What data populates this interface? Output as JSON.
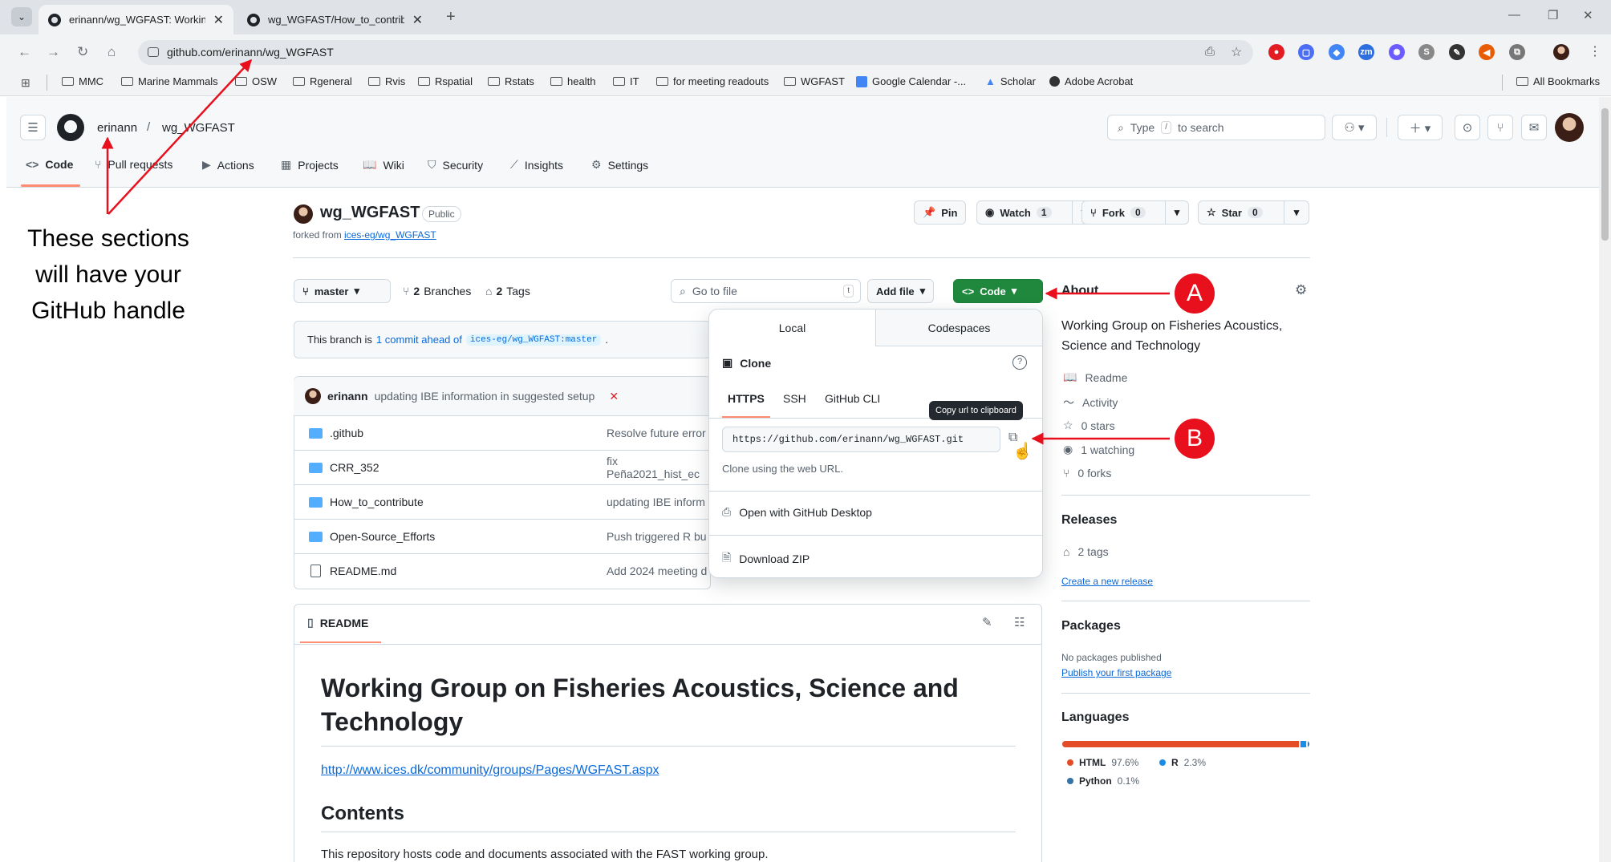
{
  "browser": {
    "tabs": [
      {
        "title": "erinann/wg_WGFAST: Working",
        "active": true
      },
      {
        "title": "wg_WGFAST/How_to_contribut",
        "active": false
      }
    ],
    "new_tab": "+",
    "url": "github.com/erinann/wg_WGFAST",
    "bookmarks": [
      "MMC",
      "Marine Mammals",
      "OSW",
      "Rgeneral",
      "Rvis",
      "Rspatial",
      "Rstats",
      "health",
      "IT",
      "for meeting readouts",
      "WGFAST",
      "Google Calendar -...",
      "Scholar",
      "Adobe Acrobat"
    ],
    "all_bookmarks": "All Bookmarks",
    "ext_zm": "zm",
    "ext_s": "S"
  },
  "header": {
    "owner": "erinann",
    "separator": "/",
    "repo": "wg_WGFAST",
    "search_placeholder_pre": "Type",
    "search_kbd": "/",
    "search_placeholder_post": "to search",
    "nav": [
      "Code",
      "Pull requests",
      "Actions",
      "Projects",
      "Wiki",
      "Security",
      "Insights",
      "Settings"
    ]
  },
  "repo": {
    "name": "wg_WGFAST",
    "visibility": "Public",
    "forked_from_label": "forked from",
    "forked_from": "ices-eg/wg_WGFAST",
    "pin": "Pin",
    "watch": "Watch",
    "watch_count": "1",
    "fork": "Fork",
    "fork_count": "0",
    "star": "Star",
    "star_count": "0",
    "branch": "master",
    "branches_count": "2",
    "branches_label": "Branches",
    "tags_count": "2",
    "tags_label": "Tags",
    "go_to_file": "Go to file",
    "go_to_file_kbd": "t",
    "add_file": "Add file",
    "code_button": "Code",
    "ahead_pre": "This branch is",
    "ahead_link": "1 commit ahead of",
    "ahead_ref": "ices-eg/wg_WGFAST:master",
    "ahead_post": ".",
    "commit_author": "erinann",
    "commit_message": "updating IBE information in suggested setup",
    "commit_status": "✕",
    "files": [
      {
        "name": ".github",
        "type": "dir",
        "message": "Resolve future error"
      },
      {
        "name": "CRR_352",
        "type": "dir",
        "message": "fix Peña2021_hist_ec"
      },
      {
        "name": "How_to_contribute",
        "type": "dir",
        "message": "updating IBE inform"
      },
      {
        "name": "Open-Source_Efforts",
        "type": "dir",
        "message": "Push triggered R bu"
      },
      {
        "name": "README.md",
        "type": "file",
        "message": "Add 2024 meeting d"
      }
    ],
    "readme_tab": "README",
    "readme_title": "Working Group on Fisheries Acoustics, Science and Technology",
    "readme_link": "http://www.ices.dk/community/groups/Pages/WGFAST.aspx",
    "readme_contents": "Contents",
    "readme_para": "This repository hosts code and documents associated with the FAST working group."
  },
  "code_dropdown": {
    "tabs": [
      "Local",
      "Codespaces"
    ],
    "clone_title": "Clone",
    "protocols": [
      "HTTPS",
      "SSH",
      "GitHub CLI"
    ],
    "clone_url": "https://github.com/erinann/wg_WGFAST.git",
    "hint": "Clone using the web URL.",
    "desktop": "Open with GitHub Desktop",
    "zip": "Download ZIP",
    "tooltip": "Copy url to clipboard"
  },
  "sidebar": {
    "about_title": "About",
    "description": "Working Group on Fisheries Acoustics, Science and Technology",
    "readme": "Readme",
    "activity": "Activity",
    "stars": "0 stars",
    "watching": "1 watching",
    "forks": "0 forks",
    "releases_title": "Releases",
    "tags": "2 tags",
    "create_release": "Create a new release",
    "packages_title": "Packages",
    "no_packages": "No packages published",
    "publish_package": "Publish your first package",
    "languages_title": "Languages",
    "languages": [
      {
        "name": "HTML",
        "percent": "97.6%",
        "value": 97.6,
        "color": "#e34c26"
      },
      {
        "name": "R",
        "percent": "2.3%",
        "value": 2.3,
        "color": "#198ce7"
      },
      {
        "name": "Python",
        "percent": "0.1%",
        "value": 0.1,
        "color": "#3572a5"
      }
    ]
  },
  "annotations": {
    "callout": "These sections will have your GitHub handle",
    "marker_a": "A",
    "marker_b": "B",
    "arrow_color": "#e8101d"
  }
}
